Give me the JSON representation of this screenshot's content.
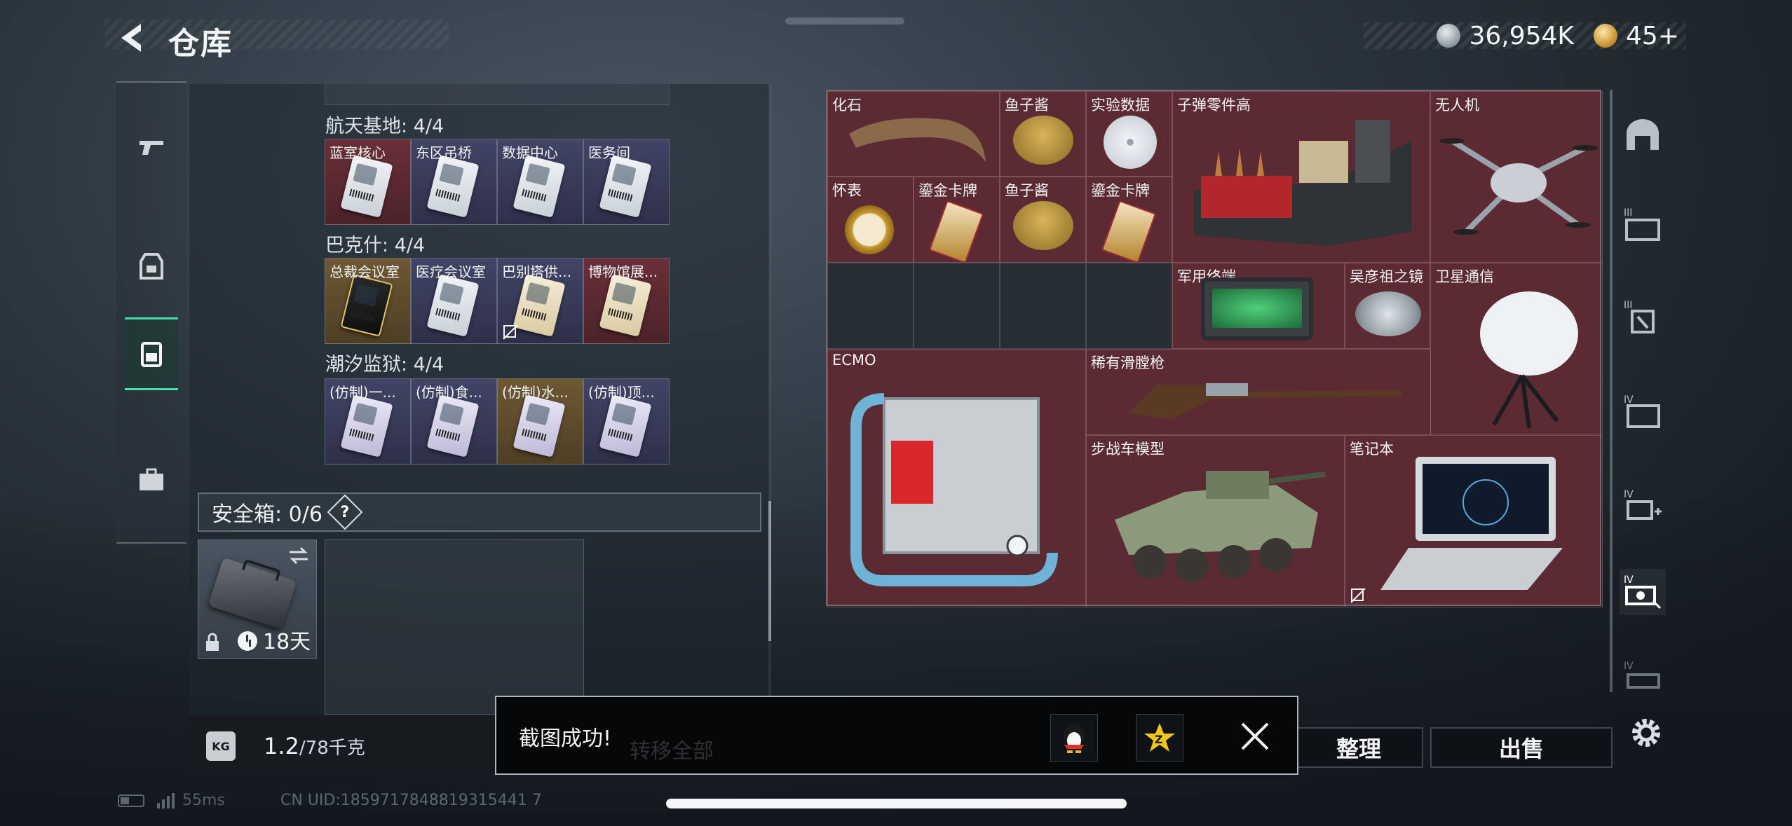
{
  "header": {
    "title": "仓库"
  },
  "currency": {
    "silver": "36,954K",
    "gold": "45",
    "plus": "+"
  },
  "left_nav": [
    "weapon",
    "armor",
    "backpack",
    "briefcase"
  ],
  "sections": [
    {
      "title": "航天基地: 4/4",
      "cards": [
        {
          "label": "蓝室核心",
          "bg": "red",
          "card": "white"
        },
        {
          "label": "东区吊桥",
          "bg": "purple",
          "card": "white"
        },
        {
          "label": "数据中心",
          "bg": "purple",
          "card": "white"
        },
        {
          "label": "医务间",
          "bg": "purple",
          "card": "white"
        }
      ]
    },
    {
      "title": "巴克什: 4/4",
      "cards": [
        {
          "label": "总裁会议室",
          "bg": "gold",
          "card": "black"
        },
        {
          "label": "医疗会议室",
          "bg": "purple",
          "card": "white"
        },
        {
          "label": "巴别塔供...",
          "bg": "purple",
          "card": "cream"
        },
        {
          "label": "博物馆展...",
          "bg": "red",
          "card": "cream"
        }
      ]
    },
    {
      "title": "潮汐监狱: 4/4",
      "cards": [
        {
          "label": "(仿制)一...",
          "bg": "purple",
          "card": "lav"
        },
        {
          "label": "(仿制)食...",
          "bg": "purple",
          "card": "lav"
        },
        {
          "label": "(仿制)水...",
          "bg": "gold",
          "card": "lav"
        },
        {
          "label": "(仿制)顶...",
          "bg": "purple",
          "card": "lav"
        }
      ]
    }
  ],
  "safe": {
    "label": "安全箱: 0/6",
    "help": "?",
    "days": "18天"
  },
  "weight": {
    "current": "1.2",
    "max": "/78千克",
    "icon": "KG"
  },
  "items": {
    "fossil": "化石",
    "caviar1": "鱼子酱",
    "data": "实验数据",
    "ammo": "子弹零件高",
    "drone": "无人机",
    "watch": "怀表",
    "card1": "鎏金卡牌",
    "caviar2": "鱼子酱",
    "card2": "鎏金卡牌",
    "terminal": "军用终端",
    "mirror": "吴彦祖之镜",
    "satellite": "卫星通信",
    "ecmo": "ECMO",
    "musket": "稀有滑膛枪",
    "ifv": "步战车模型",
    "laptop": "笔记本"
  },
  "right_tabs": [
    "base",
    "III",
    "III",
    "IV",
    "IV",
    "IV",
    "IV"
  ],
  "buttons": {
    "sort": "整理",
    "sell": "出售"
  },
  "toast": {
    "text": "截图成功!",
    "under": "转移全部"
  },
  "status": {
    "ping": "55ms",
    "uid": "CN UID:1859717848819315441 7"
  },
  "colors": {
    "accent": "#42e0a5",
    "cell_red": "#5b2a33",
    "cell_empty": "#262d34"
  }
}
